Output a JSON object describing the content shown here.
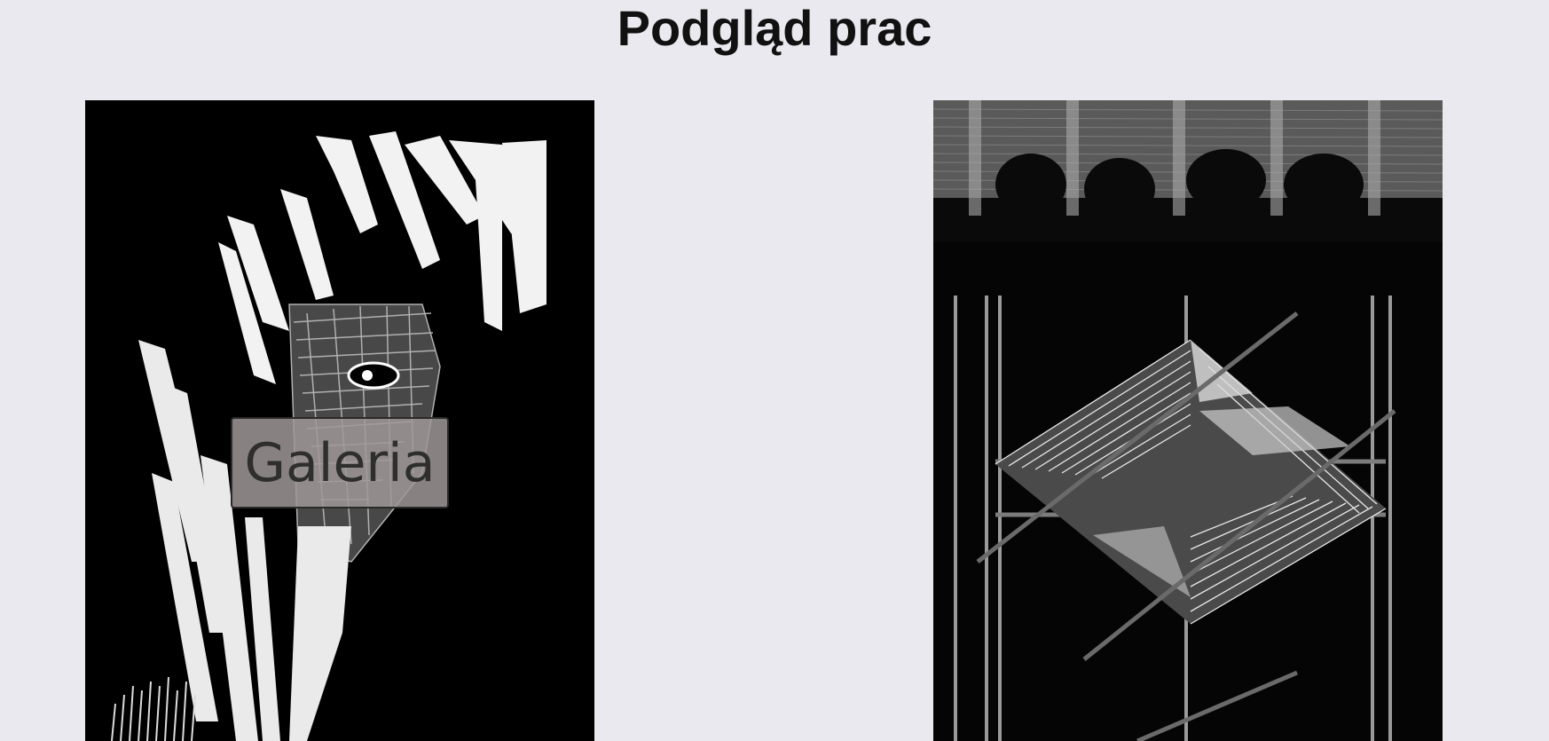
{
  "header": {
    "title": "Podgląd prac"
  },
  "gallery": {
    "button_label": "Galeria",
    "items": [
      {
        "name": "artwork-left",
        "icon": "woodcut-face-artwork"
      },
      {
        "name": "artwork-right",
        "icon": "geometric-lines-artwork"
      }
    ]
  },
  "colors": {
    "background": "#e9e9ef",
    "title": "#111111",
    "artwork_bg": "#000000"
  }
}
